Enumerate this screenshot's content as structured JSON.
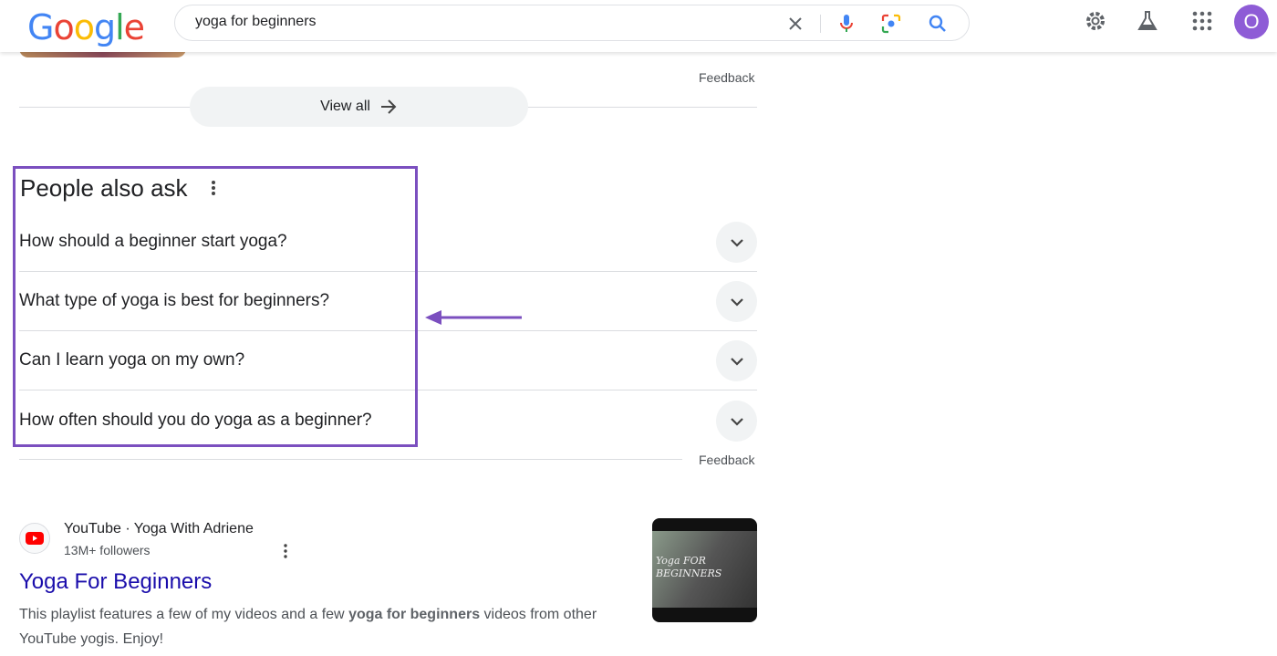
{
  "header": {
    "logo": "Google",
    "query": "yoga for beginners",
    "avatar_letter": "O",
    "icons": [
      "close-icon",
      "mic-icon",
      "lens-icon",
      "search-icon",
      "gear-icon",
      "labs-icon",
      "apps-icon"
    ]
  },
  "top": {
    "feedback": "Feedback",
    "view_all": "View all"
  },
  "paa": {
    "title": "People also ask",
    "questions": [
      "How should a beginner start yoga?",
      "What type of yoga is best for beginners?",
      "Can I learn yoga on my own?",
      "How often should you do yoga as a beginner?"
    ],
    "feedback": "Feedback",
    "highlight_color": "#7b4fbf"
  },
  "result": {
    "source": "YouTube · Yoga With Adriene",
    "followers": "13M+ followers",
    "title": "Yoga For Beginners",
    "snippet_pre": "This playlist features a few of my videos and a few ",
    "snippet_bold": "yoga for beginners",
    "snippet_post": " videos from other YouTube yogis. Enjoy!",
    "thumb_text": "Yoga FOR BEGINNERS"
  }
}
